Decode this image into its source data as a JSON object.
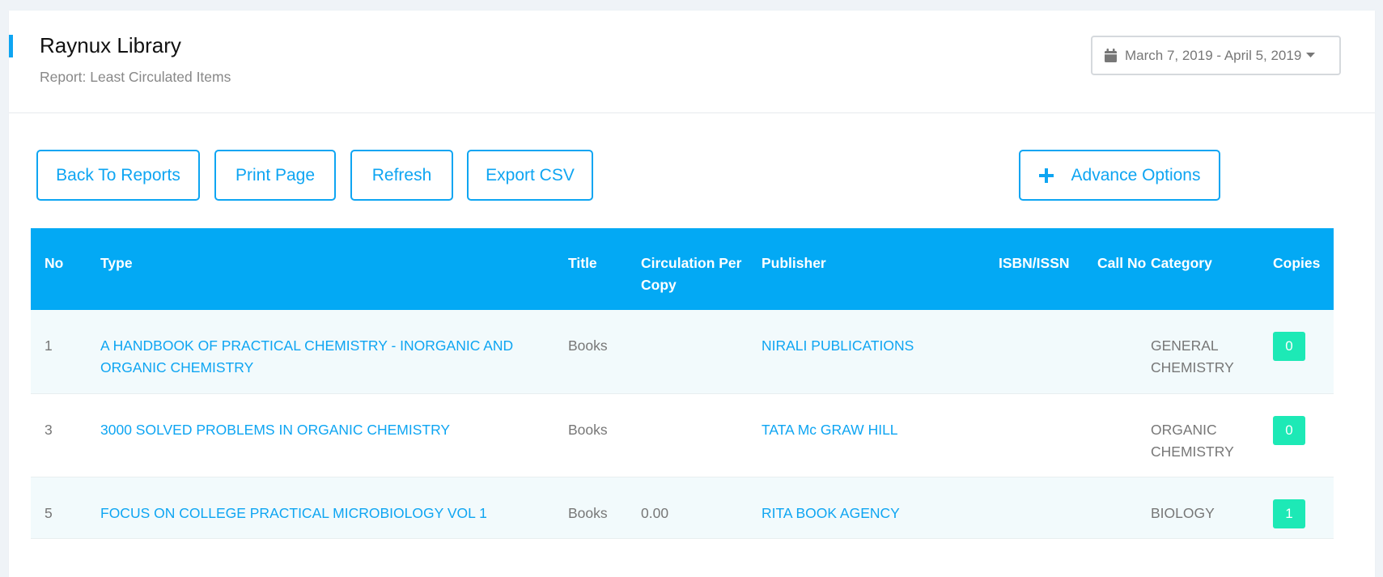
{
  "header": {
    "title": "Raynux Library",
    "subtitle": "Report: Least Circulated Items",
    "date_range": "March 7, 2019 - April 5, 2019",
    "accent_color": "#0ea5f2"
  },
  "toolbar": {
    "back_label": "Back To Reports",
    "print_label": "Print Page",
    "refresh_label": "Refresh",
    "export_label": "Export CSV",
    "advance_label": "Advance Options"
  },
  "table": {
    "columns": [
      "No",
      "Type",
      "Title",
      "Circulation Per Copy",
      "Publisher",
      "ISBN/ISSN",
      "Call No",
      "Category",
      "Copies"
    ],
    "rows": [
      {
        "no": "1",
        "type": "A HANDBOOK OF PRACTICAL CHEMISTRY - INORGANIC AND ORGANIC CHEMISTRY",
        "title": "Books",
        "circulation": "",
        "publisher": "NIRALI PUBLICATIONS",
        "isbn": "",
        "call_no": "",
        "category": "GENERAL CHEMISTRY",
        "copies": "0"
      },
      {
        "no": "3",
        "type": "3000 SOLVED PROBLEMS IN ORGANIC CHEMISTRY",
        "title": "Books",
        "circulation": "",
        "publisher": "TATA Mc GRAW HILL",
        "isbn": "",
        "call_no": "",
        "category": "ORGANIC CHEMISTRY",
        "copies": "0"
      },
      {
        "no": "5",
        "type": "FOCUS ON COLLEGE PRACTICAL MICROBIOLOGY VOL 1",
        "title": "Books",
        "circulation": "0.00",
        "publisher": "RITA BOOK AGENCY",
        "isbn": "",
        "call_no": "",
        "category": "BIOLOGY",
        "copies": "1"
      }
    ]
  },
  "icons": {
    "calendar": "calendar-icon",
    "caret": "caret-down-icon",
    "plus": "plus-icon"
  },
  "colors": {
    "header_bg": "#03a9f4",
    "badge_bg": "#1de9b6",
    "link": "#0ea5f2"
  }
}
